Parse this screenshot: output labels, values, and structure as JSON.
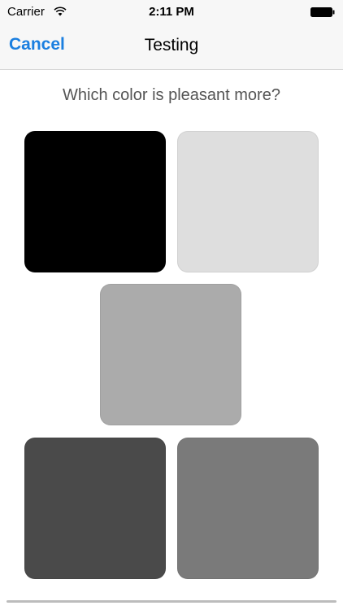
{
  "status_bar": {
    "carrier": "Carrier",
    "time": "2:11 PM",
    "icons": [
      "wifi-icon",
      "battery-icon"
    ]
  },
  "nav": {
    "cancel_label": "Cancel",
    "title": "Testing"
  },
  "question": "Which color is pleasant more?",
  "colors": {
    "accent": "#1b7fe0",
    "swatches": [
      "#000000",
      "#dedede",
      "#ababab",
      "#4a4a4a",
      "#7a7a7a"
    ]
  }
}
